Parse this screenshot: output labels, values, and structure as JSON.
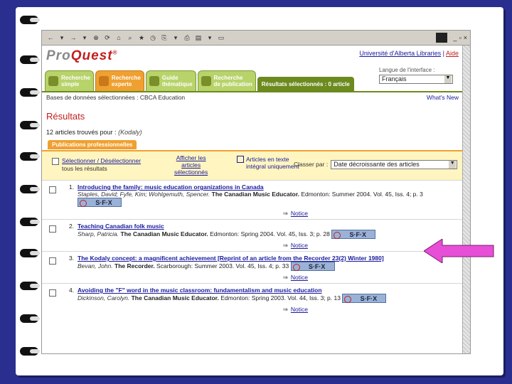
{
  "browser": {
    "toolbar_glyphs": [
      "←",
      "▾",
      "→",
      "▾",
      "⊗",
      "⟳",
      "⌂",
      "⌕",
      "★",
      "◷",
      "⎘",
      "▾",
      "⎙",
      "▤",
      "▾",
      "▭"
    ],
    "window_controls": [
      "_",
      "▫",
      "×"
    ]
  },
  "header": {
    "logo_prefix": "Pro",
    "logo_suffix": "Quest",
    "logo_mark": "®",
    "university": "Université d'Alberta Libraries",
    "separator": " | ",
    "aide": "Aide"
  },
  "tabs": [
    {
      "label": "Recherche\nsimple",
      "active": false
    },
    {
      "label": "Recherche\nexperte",
      "active": true
    },
    {
      "label": "Guide\nthématique",
      "active": false
    },
    {
      "label": "Recherche\nde publication",
      "active": false
    }
  ],
  "selected_tab": "Résultats sélectionnés : 0 article",
  "language": {
    "label": "Langue de l'interface :",
    "value": "Français"
  },
  "db_line": {
    "text": "Bases de données sélectionnées : CBCA Education",
    "whats_new": "What's New"
  },
  "results_heading": "Résultats",
  "found": {
    "text": "12 articles trouvés pour :",
    "query": "(Kodaly)"
  },
  "subtab": "Publications professionnelles",
  "actions": {
    "select_label": "Sélectionner / Désélectionner",
    "select_sub": "tous les résultats",
    "show_selected": "Afficher les\narticles\nsélectionnés",
    "fulltext_only": "Articles en texte\nintégral uniquement",
    "sort_label": "Classer par :",
    "sort_value": "Date décroissante des articles"
  },
  "results": [
    {
      "num": "1.",
      "title": "Introducing the family: music education organizations in Canada",
      "authors": "Staples, David; Fyfe, Kim; Wohlgemuth, Spencer.",
      "source": "The Canadian Music Educator.",
      "details": " Edmonton: Summer 2004. Vol. 45, Iss. 4; p. 3",
      "sfx": "S·F·X",
      "notice": "Notice"
    },
    {
      "num": "2.",
      "title": "Teaching Canadian folk music",
      "authors": "Sharp, Patricia.",
      "source": "The Canadian Music Educator.",
      "details": " Edmonton: Spring 2004. Vol. 45, Iss. 3; p. 28",
      "sfx": "S·F·X",
      "notice": "Notice"
    },
    {
      "num": "3.",
      "title": "The Kodaly concept: a magnificent achievement [Reprint of an article from the Recorder 23(2) Winter 1980]",
      "authors": "Bevan, John.",
      "source": "The Recorder.",
      "details": " Scarborough: Summer 2003. Vol. 45, Iss. 4; p. 33",
      "sfx": "S·F·X",
      "notice": "Notice"
    },
    {
      "num": "4.",
      "title": "Avoiding the \"F\" word in the music classroom: fundamentalism and music education",
      "authors": "Dickinson, Carolyn.",
      "source": "The Canadian Music Educator.",
      "details": " Edmonton: Spring 2003. Vol. 44, Iss. 3; p. 13",
      "sfx": "S·F·X",
      "notice": "Notice"
    }
  ],
  "colors": {
    "slide_bg": "#2a2e8f",
    "arrow": "#e64fd6",
    "brand_red": "#c41e1e",
    "link": "#1a1a9c",
    "tab_green": "#b7d36a",
    "tab_orange": "#f0a030"
  }
}
